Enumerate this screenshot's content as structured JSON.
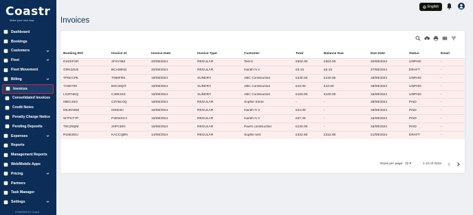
{
  "app": {
    "logo": "Coastr",
    "tagline": "Make your own way",
    "powered_by": "POWERED BY Coastr"
  },
  "topbar": {
    "language": "English"
  },
  "sidebar": {
    "items": [
      {
        "label": "Dashboard",
        "icon": "dashboard-icon",
        "chevron": false
      },
      {
        "label": "Bookings",
        "icon": "bookings-icon",
        "chevron": false
      },
      {
        "label": "Customers",
        "icon": "customers-icon",
        "chevron": true
      },
      {
        "label": "Fleet",
        "icon": "fleet-icon",
        "chevron": true
      },
      {
        "label": "Fleet Movement",
        "icon": "fleet-movement-icon",
        "chevron": false
      },
      {
        "label": "Billing",
        "icon": "billing-icon",
        "chevron": true
      },
      {
        "label": "Invoices",
        "icon": "invoices-icon",
        "chevron": false,
        "active": true
      },
      {
        "label": "Consolidated Invoices",
        "icon": "consolidated-invoices-icon",
        "chevron": false
      },
      {
        "label": "Credit Notes",
        "icon": "credit-notes-icon",
        "chevron": false
      },
      {
        "label": "Penalty Charge Notice",
        "icon": "penalty-icon",
        "chevron": false
      },
      {
        "label": "Pending Deposits",
        "icon": "deposits-icon",
        "chevron": false
      },
      {
        "label": "Expenses",
        "icon": "expenses-icon",
        "chevron": true
      },
      {
        "label": "Reports",
        "icon": "reports-icon",
        "chevron": false
      },
      {
        "label": "Management Reports",
        "icon": "management-reports-icon",
        "chevron": false
      },
      {
        "label": "Web/Mobile Apps",
        "icon": "apps-icon",
        "chevron": false
      },
      {
        "label": "Pricing",
        "icon": "pricing-icon",
        "chevron": true
      },
      {
        "label": "Partners",
        "icon": "partners-icon",
        "chevron": false
      },
      {
        "label": "Task Manager",
        "icon": "task-manager-icon",
        "chevron": false
      },
      {
        "label": "Settings",
        "icon": "settings-icon",
        "chevron": true
      }
    ]
  },
  "main": {
    "title": "Invoices",
    "table": {
      "headers": [
        "Booking Ref.",
        "Invoice Id",
        "Invoice Date",
        "Invoice Type",
        "Customer",
        "Total",
        "Balance Due",
        "Due Date",
        "Status",
        "Email"
      ],
      "rows": [
        [
          "DSZKFXR",
          "4FXV35Z",
          "20/08/2024",
          "REGULAR",
          "Test K",
          "£504.00",
          "£504.00",
          "20/08/2024",
          "UNPAID",
          "-"
        ],
        [
          "GRK2ZU6",
          "BCA66NG",
          "20/08/2024",
          "REGULAR",
          "Harish N V",
          "£5.15",
          "£5.15",
          "27/08/2024",
          "DRAFT",
          "-"
        ],
        [
          "TP6CCP6",
          "T065FR6",
          "19/08/2024",
          "SUNDRY",
          "ABC Construction",
          "£220.00",
          "£220.00",
          "18/09/2024",
          "UNPAID",
          "-"
        ],
        [
          "7A9D700",
          "B2CWQIT",
          "19/08/2024",
          "SUNDRY",
          "ABC Construction",
          "£10.00",
          "£10.00",
          "18/09/2024",
          "UNPAID",
          "-"
        ],
        [
          "LXZFHEQ",
          "C36K3X0",
          "19/08/2024",
          "SUNDRY",
          "ABC Construction",
          "£100.00",
          "£100.00",
          "18/09/2024",
          "UNPAID",
          "-"
        ],
        [
          "06EC46O",
          "C0YB1OQ",
          "19/08/2024",
          "REGULAR",
          "Sophie Stone",
          "-",
          "-",
          "26/08/2024",
          "PAID",
          "-"
        ],
        [
          "DEJKNWZ",
          "IDKEI8J",
          "19/08/2024",
          "REGULAR",
          "Harish N V",
          "£24.00",
          "-",
          "19/08/2024",
          "PAID",
          "-"
        ],
        [
          "W7FKT7P",
          "P2EWXC4",
          "16/08/2024",
          "REGULAR",
          "Harish N V",
          "£67.25",
          "-",
          "16/08/2024",
          "PAID",
          "-"
        ],
        [
          "T6CZ8QM",
          "2HPCEKI",
          "15/08/2024",
          "REGULAR",
          "Paul's construction",
          "£120.00",
          "-",
          "15/08/2024",
          "PAID",
          "-"
        ],
        [
          "R16EZDU",
          "KACCQBN",
          "14/08/2024",
          "REGULAR",
          "Sophie test",
          "£322.80",
          "£322.80",
          "21/08/2024",
          "DRAFT",
          "-"
        ]
      ]
    },
    "pagination": {
      "rows_per_page_label": "Rows per page:",
      "rows_per_page": "10",
      "range": "1-10 of 3322"
    }
  },
  "colors": {
    "sidebar_bg": "#0b2d57",
    "row_bg": "#fdeeee",
    "active_border": "#e0202a"
  }
}
